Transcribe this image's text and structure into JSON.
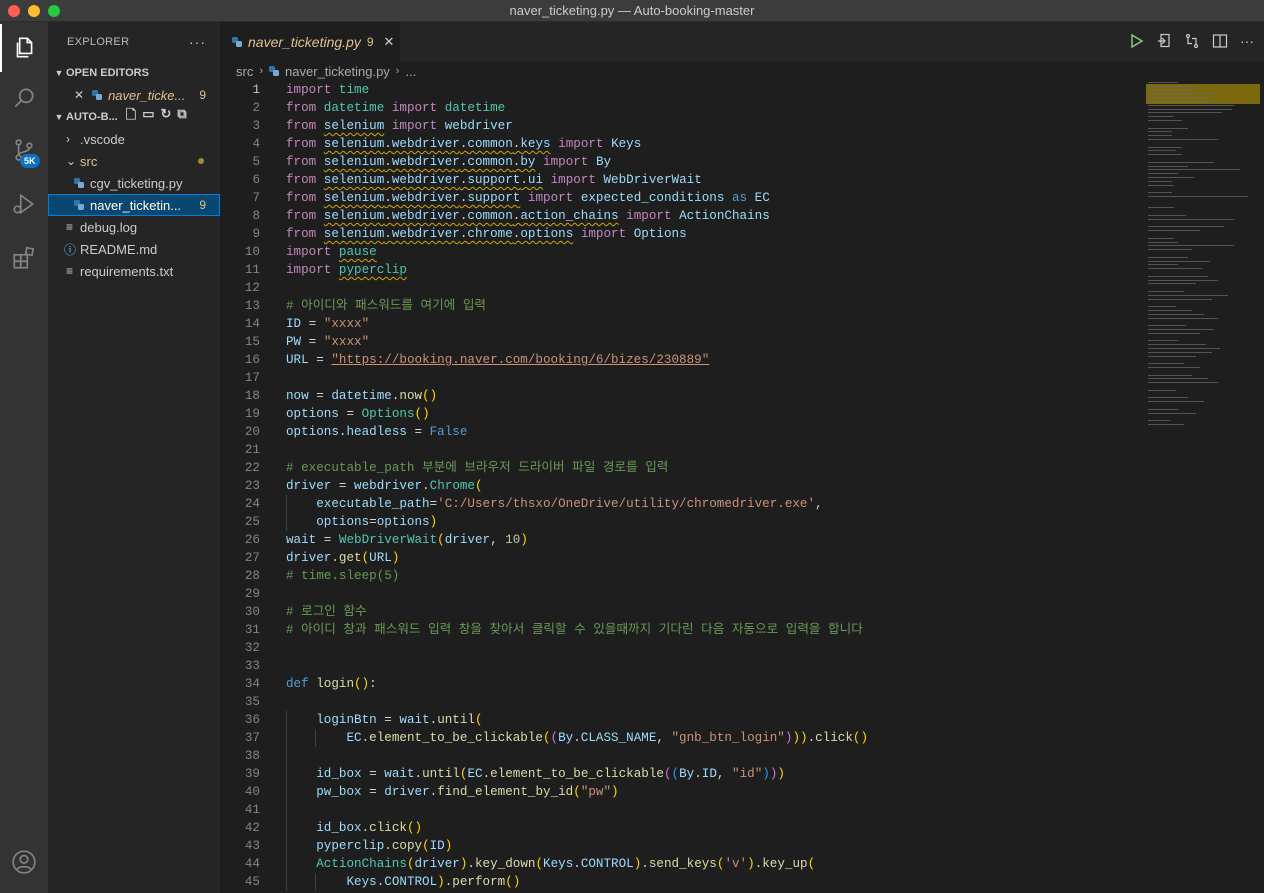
{
  "window": {
    "title": "naver_ticketing.py — Auto-booking-master"
  },
  "activity_bar": {
    "scm_badge": "5K"
  },
  "sidebar": {
    "title": "EXPLORER",
    "more": "···",
    "open_editors": {
      "label": "OPEN EDITORS",
      "items": [
        {
          "name": "naver_ticke...",
          "count": "9"
        }
      ]
    },
    "project": {
      "label": "AUTO-B...",
      "tree": [
        {
          "name": ".vscode",
          "kind": "folder-collapsed"
        },
        {
          "name": "src",
          "kind": "folder-open"
        },
        {
          "name": "cgv_ticketing.py",
          "kind": "py"
        },
        {
          "name": "naver_ticketin...",
          "kind": "py",
          "count": "9",
          "selected": true
        },
        {
          "name": "debug.log",
          "kind": "lines"
        },
        {
          "name": "README.md",
          "kind": "info"
        },
        {
          "name": "requirements.txt",
          "kind": "lines"
        }
      ]
    }
  },
  "tab": {
    "label": "naver_ticketing.py",
    "count": "9",
    "close": "✕"
  },
  "breadcrumb": {
    "parts": [
      "src",
      "naver_ticketing.py",
      "..."
    ]
  },
  "editor": {
    "current_line": 1,
    "lines": [
      {
        "n": "1",
        "t": "import time"
      },
      {
        "n": "2",
        "t": "from datetime import datetime"
      },
      {
        "n": "3",
        "t": "from selenium import webdriver"
      },
      {
        "n": "4",
        "t": "from selenium.webdriver.common.keys import Keys"
      },
      {
        "n": "5",
        "t": "from selenium.webdriver.common.by import By"
      },
      {
        "n": "6",
        "t": "from selenium.webdriver.support.ui import WebDriverWait"
      },
      {
        "n": "7",
        "t": "from selenium.webdriver.support import expected_conditions as EC"
      },
      {
        "n": "8",
        "t": "from selenium.webdriver.common.action_chains import ActionChains"
      },
      {
        "n": "9",
        "t": "from selenium.webdriver.chrome.options import Options"
      },
      {
        "n": "10",
        "t": "import pause"
      },
      {
        "n": "11",
        "t": "import pyperclip"
      },
      {
        "n": "12",
        "t": ""
      },
      {
        "n": "13",
        "t": "# 아이디와 패스워드를 여기에 입력"
      },
      {
        "n": "14",
        "t": "ID = \"xxxx\""
      },
      {
        "n": "15",
        "t": "PW = \"xxxx\""
      },
      {
        "n": "16",
        "t": "URL = \"https://booking.naver.com/booking/6/bizes/230889\""
      },
      {
        "n": "17",
        "t": ""
      },
      {
        "n": "18",
        "t": "now = datetime.now()"
      },
      {
        "n": "19",
        "t": "options = Options()"
      },
      {
        "n": "20",
        "t": "options.headless = False"
      },
      {
        "n": "21",
        "t": ""
      },
      {
        "n": "22",
        "t": "# executable_path 부분에 브라우저 드라이버 파일 경로를 입력"
      },
      {
        "n": "23",
        "t": "driver = webdriver.Chrome("
      },
      {
        "n": "24",
        "t": "    executable_path='C:/Users/thsxo/OneDrive/utility/chromedriver.exe',"
      },
      {
        "n": "25",
        "t": "    options=options)"
      },
      {
        "n": "26",
        "t": "wait = WebDriverWait(driver, 10)"
      },
      {
        "n": "27",
        "t": "driver.get(URL)"
      },
      {
        "n": "28",
        "t": "# time.sleep(5)"
      },
      {
        "n": "29",
        "t": ""
      },
      {
        "n": "30",
        "t": "# 로그인 함수"
      },
      {
        "n": "31",
        "t": "# 아이디 창과 패스워드 입력 창을 찾아서 클릭할 수 있을때까지 기다린 다음 자동으로 입력을 합니다"
      },
      {
        "n": "32",
        "t": ""
      },
      {
        "n": "33",
        "t": ""
      },
      {
        "n": "34",
        "t": "def login():"
      },
      {
        "n": "35",
        "t": ""
      },
      {
        "n": "36",
        "t": "    loginBtn = wait.until("
      },
      {
        "n": "37",
        "t": "        EC.element_to_be_clickable((By.CLASS_NAME, \"gnb_btn_login\"))).click()"
      },
      {
        "n": "38",
        "t": ""
      },
      {
        "n": "39",
        "t": "    id_box = wait.until(EC.element_to_be_clickable((By.ID, \"id\")))"
      },
      {
        "n": "40",
        "t": "    pw_box = driver.find_element_by_id(\"pw\")"
      },
      {
        "n": "41",
        "t": ""
      },
      {
        "n": "42",
        "t": "    id_box.click()"
      },
      {
        "n": "43",
        "t": "    pyperclip.copy(ID)"
      },
      {
        "n": "44",
        "t": "    ActionChains(driver).key_down(Keys.CONTROL).send_keys('v').key_up("
      },
      {
        "n": "45",
        "t": "        Keys.CONTROL).perform()"
      }
    ]
  },
  "colors": {
    "accent": "#007fd4",
    "warning": "#e2c08d",
    "squiggle": "#cca700",
    "keyword": "#569cd6",
    "control": "#c586c0",
    "module": "#4ec9b0",
    "function": "#dcdcaa",
    "variable": "#9cdcfe",
    "string": "#ce9178",
    "comment": "#6a9955"
  }
}
